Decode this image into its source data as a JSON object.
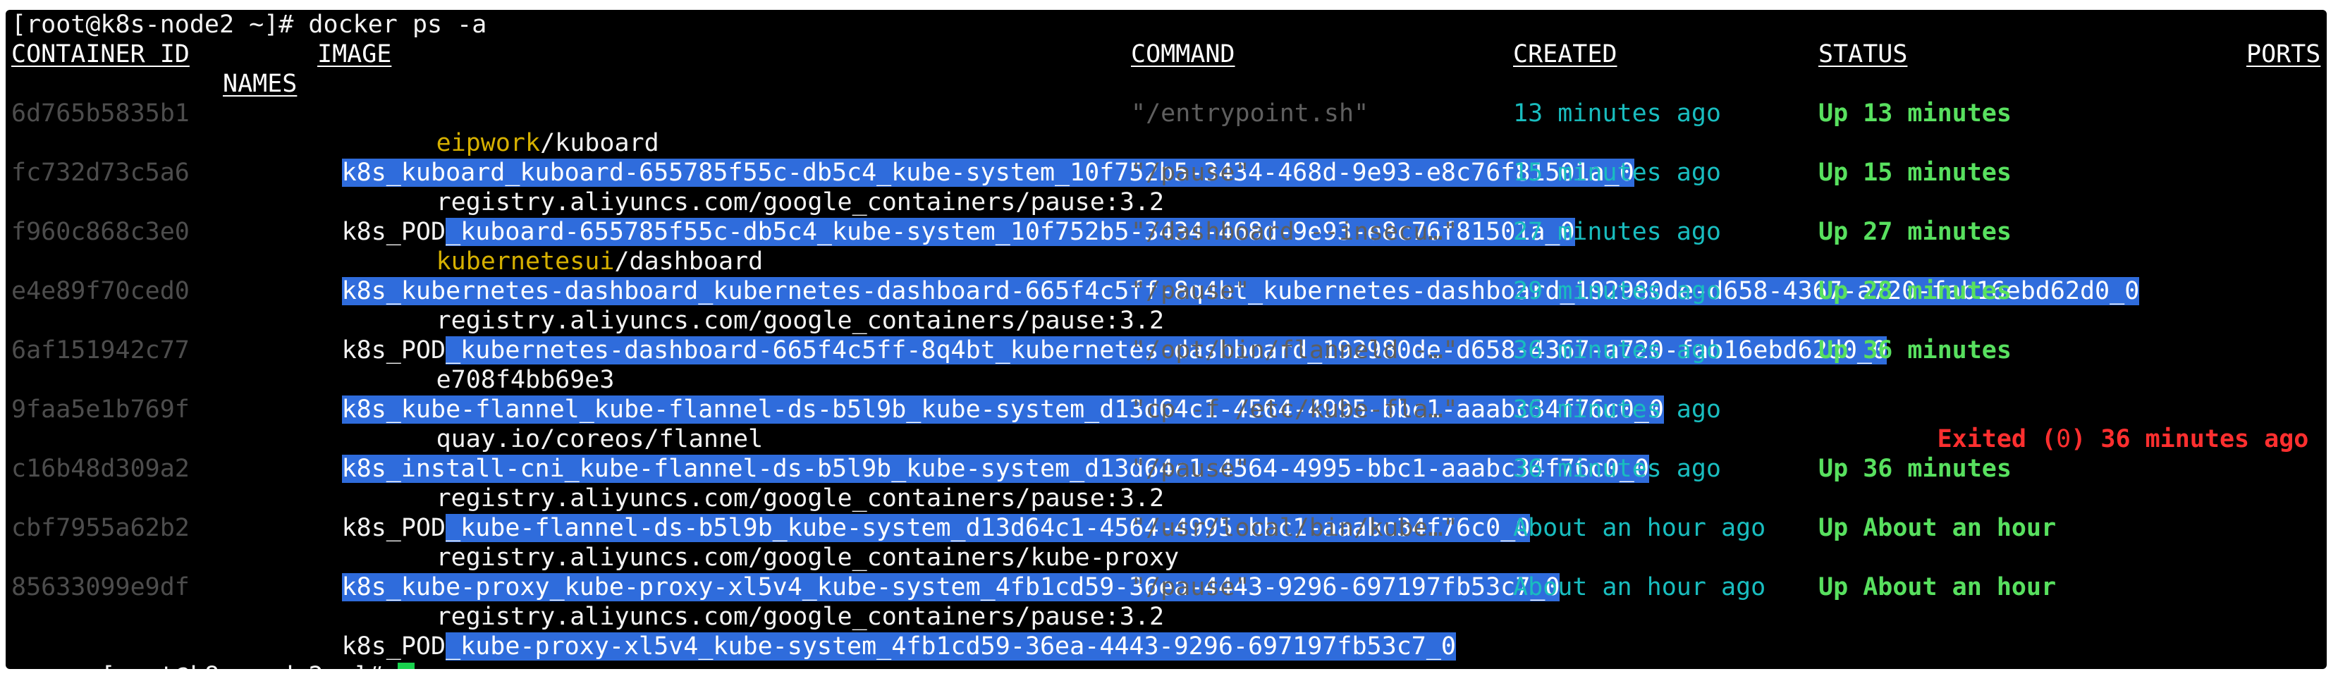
{
  "terminal": {
    "prompt_before": "[root@k8s-node2 ~]# docker ps -a",
    "prompt_after": "[root@k8s-node2 ~]# ",
    "headers": {
      "container_id": "CONTAINER ID",
      "image": "IMAGE",
      "command": "COMMAND",
      "created": "CREATED",
      "status": "STATUS",
      "ports": "PORTS",
      "names": "NAMES"
    },
    "rows": [
      {
        "id": "6d765b5835b1",
        "image_prefix": "eipwork",
        "image_suffix": "/kuboard",
        "command": "\"/entrypoint.sh\"",
        "created": "13 minutes ago",
        "status": "Up 13 minutes",
        "name_prefix": "",
        "name_highlight": "k8s_kuboard_kuboard-655785f55c-db5c4_kube-system_10f752b5-3434-468d-9e93-e8c76f81501a_0"
      },
      {
        "id": "fc732d73c5a6",
        "image_prefix": "",
        "image_suffix": "registry.aliyuncs.com/google_containers/pause:3.2",
        "command": "\"/pause\"",
        "created": "15 minutes ago",
        "status": "Up 15 minutes",
        "name_prefix": "k8s_POD",
        "name_highlight": "_kuboard-655785f55c-db5c4_kube-system_10f752b5-3434-468d-9e93-e8c76f81501a_0"
      },
      {
        "id": "f960c868c3e0",
        "image_prefix": "kubernetesui",
        "image_suffix": "/dashboard",
        "command": "\"/dashboard --insecu…\"",
        "created": "27 minutes ago",
        "status": "Up 27 minutes",
        "name_prefix": "",
        "name_highlight": "k8s_kubernetes-dashboard_kubernetes-dashboard-665f4c5ff-8q4bt_kubernetes-dashboard_192980de-d658-4367-a720-fab16ebd62d0_0"
      },
      {
        "id": "e4e89f70ced0",
        "image_prefix": "",
        "image_suffix": "registry.aliyuncs.com/google_containers/pause:3.2",
        "command": "\"/pause\"",
        "created": "29 minutes ago",
        "status": "Up 28 minutes",
        "name_prefix": "k8s_POD",
        "name_highlight": "_kubernetes-dashboard-665f4c5ff-8q4bt_kubernetes-dashboard_192980de-d658-4367-a720-fab16ebd62d0_0"
      },
      {
        "id": "6af151942c77",
        "image_prefix": "",
        "image_suffix": "e708f4bb69e3",
        "command": "\"/opt/bin/flanneld -…\"",
        "created": "36 minutes ago",
        "status": "Up 36 minutes",
        "name_prefix": "",
        "name_highlight": "k8s_kube-flannel_kube-flannel-ds-b5l9b_kube-system_d13d64c1-4564-4995-bbc1-aaabc34f76c0_0"
      },
      {
        "id": "9faa5e1b769f",
        "image_prefix": "",
        "image_suffix": "quay.io/coreos/flannel",
        "command": "\"cp -f /etc/kube-fla…\"",
        "created": "36 minutes ago",
        "status_exited_a": "Exited (",
        "status_exited_code": "0",
        "status_exited_b": ") 36 minutes ago",
        "name_prefix": "",
        "name_highlight": "k8s_install-cni_kube-flannel-ds-b5l9b_kube-system_d13d64c1-4564-4995-bbc1-aaabc34f76c0_0"
      },
      {
        "id": "c16b48d309a2",
        "image_prefix": "",
        "image_suffix": "registry.aliyuncs.com/google_containers/pause:3.2",
        "command": "\"/pause\"",
        "created": "36 minutes ago",
        "status": "Up 36 minutes",
        "name_prefix": "k8s_POD",
        "name_highlight": "_kube-flannel-ds-b5l9b_kube-system_d13d64c1-4564-4995-bbc1-aaabc34f76c0_0"
      },
      {
        "id": "cbf7955a62b2",
        "image_prefix": "",
        "image_suffix": "registry.aliyuncs.com/google_containers/kube-proxy",
        "command": "\"/usr/local/bin/kube…\"",
        "created": "About an hour ago",
        "status": "Up About an hour",
        "name_prefix": "",
        "name_highlight": "k8s_kube-proxy_kube-proxy-xl5v4_kube-system_4fb1cd59-36ea-4443-9296-697197fb53c7_0"
      },
      {
        "id": "85633099e9df",
        "image_prefix": "",
        "image_suffix": "registry.aliyuncs.com/google_containers/pause:3.2",
        "command": "\"/pause\"",
        "created": "About an hour ago",
        "status": "Up About an hour",
        "name_prefix": "k8s_POD",
        "name_highlight": "_kube-proxy-xl5v4_kube-system_4fb1cd59-36ea-4443-9296-697197fb53c7_0"
      }
    ]
  },
  "colors": {
    "background": "#000000",
    "text": "#f2f2f2",
    "muted_id": "#4d4d4d",
    "command": "#5f5f5f",
    "created": "#19bdbf",
    "up": "#58e05f",
    "exited": "#ff2f2f",
    "highlight": "#2f6cdc",
    "image_prefix": "#d6b000",
    "cursor": "#18d24d"
  }
}
